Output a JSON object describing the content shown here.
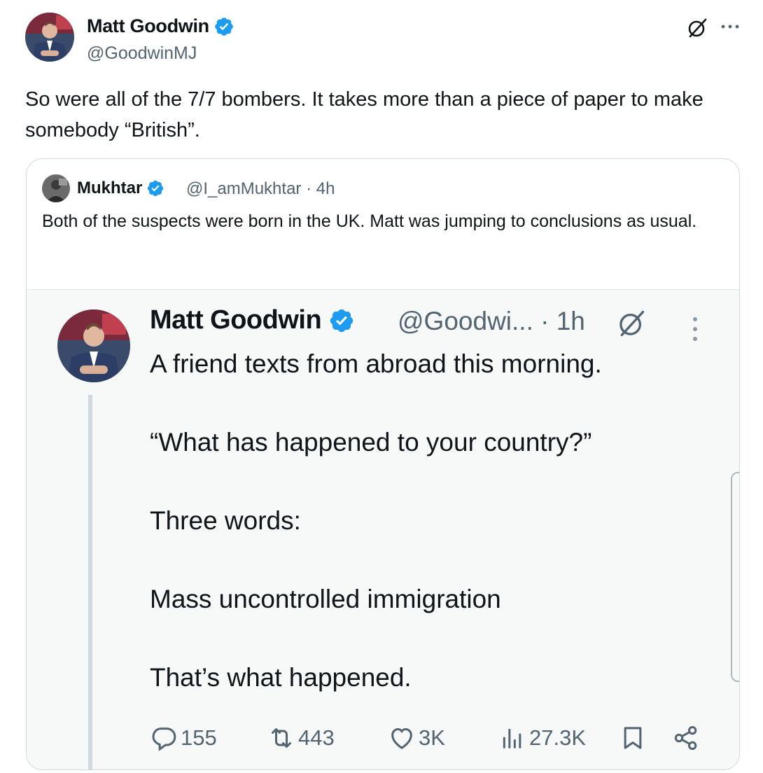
{
  "tweet": {
    "author_name": "Matt Goodwin",
    "author_handle": "@GoodwinMJ",
    "text": "So were all of the 7/7 bombers. It takes more than a piece of paper to make somebody “British”."
  },
  "quote": {
    "author_name": "Mukhtar",
    "handle_time": "@I_amMukhtar · 4h",
    "text": "Both of the suspects were born in the UK. Matt was jumping to conclusions as usual."
  },
  "embedded": {
    "author_name": "Matt Goodwin",
    "handle_time": "@Goodwi... · 1h",
    "text": "A friend texts from abroad this morning.\n\n“What has happened to your country?”\n\nThree words:\n\nMass uncontrolled immigration\n\nThat’s what happened.",
    "reply_count": "155",
    "retweet_count": "443",
    "like_count": "3K",
    "view_count": "27.3K"
  },
  "colors": {
    "verified": "#1d9bf0",
    "secondary_text": "#536471",
    "border": "#cfd9de"
  },
  "icons": [
    "verified-badge-icon",
    "grok-icon",
    "more-icon",
    "reply-icon",
    "retweet-icon",
    "like-icon",
    "views-icon",
    "bookmark-icon",
    "share-icon"
  ]
}
